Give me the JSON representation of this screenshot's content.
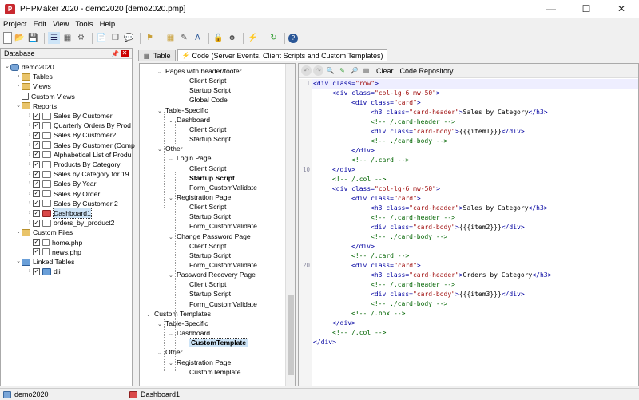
{
  "window": {
    "title": "PHPMaker 2020 - demo2020 [demo2020.pmp]",
    "logo": "P"
  },
  "menu": [
    "Project",
    "Edit",
    "View",
    "Tools",
    "Help"
  ],
  "left_panel": {
    "title": "Database",
    "items": [
      {
        "label": "demo2020",
        "indent": 0,
        "exp": "⌄",
        "icon": "db",
        "check": null
      },
      {
        "label": "Tables",
        "indent": 1,
        "exp": "›",
        "icon": "folder",
        "check": null
      },
      {
        "label": "Views",
        "indent": 1,
        "exp": "›",
        "icon": "folder",
        "check": null
      },
      {
        "label": "Custom Views",
        "indent": 1,
        "exp": "",
        "icon": "sql",
        "check": null
      },
      {
        "label": "Reports",
        "indent": 1,
        "exp": "⌄",
        "icon": "folder",
        "check": null
      },
      {
        "label": "Sales By Customer",
        "indent": 2,
        "exp": "›",
        "icon": "rep",
        "check": "✓"
      },
      {
        "label": "Quarterly Orders By Prod",
        "indent": 2,
        "exp": "›",
        "icon": "rep",
        "check": "✓"
      },
      {
        "label": "Sales By Customer2",
        "indent": 2,
        "exp": "›",
        "icon": "rep",
        "check": "✓"
      },
      {
        "label": "Sales By Customer (Comp",
        "indent": 2,
        "exp": "›",
        "icon": "rep",
        "check": "✓"
      },
      {
        "label": "Alphabetical List of Produ",
        "indent": 2,
        "exp": "›",
        "icon": "rep",
        "check": "✓"
      },
      {
        "label": "Products By Category",
        "indent": 2,
        "exp": "›",
        "icon": "rep",
        "check": "✓"
      },
      {
        "label": "Sales by Category for 19",
        "indent": 2,
        "exp": "›",
        "icon": "rep",
        "check": "✓"
      },
      {
        "label": "Sales By Year",
        "indent": 2,
        "exp": "›",
        "icon": "rep",
        "check": "✓"
      },
      {
        "label": "Sales By Order",
        "indent": 2,
        "exp": "›",
        "icon": "rep",
        "check": "✓"
      },
      {
        "label": "Sales By Customer 2",
        "indent": 2,
        "exp": "›",
        "icon": "rep",
        "check": "✓"
      },
      {
        "label": "Dashboard1",
        "indent": 2,
        "exp": "›",
        "icon": "dash",
        "check": "✓",
        "selected": true
      },
      {
        "label": "orders_by_product2",
        "indent": 2,
        "exp": "›",
        "icon": "rep",
        "check": "✓"
      },
      {
        "label": "Custom Files",
        "indent": 1,
        "exp": "⌄",
        "icon": "folder",
        "check": null
      },
      {
        "label": "home.php",
        "indent": 2,
        "exp": "",
        "icon": "file",
        "check": "✓"
      },
      {
        "label": "news.php",
        "indent": 2,
        "exp": "",
        "icon": "file",
        "check": "✓"
      },
      {
        "label": "Linked Tables",
        "indent": 1,
        "exp": "⌄",
        "icon": "link",
        "check": null
      },
      {
        "label": "dji",
        "indent": 2,
        "exp": "›",
        "icon": "link",
        "check": "✓"
      }
    ]
  },
  "tabs": [
    {
      "label": "Table",
      "active": false
    },
    {
      "label": "Code (Server Events, Client Scripts and Custom Templates)",
      "active": true
    }
  ],
  "mid_tree": [
    {
      "label": "Pages with header/footer",
      "x": 22,
      "exp": "⌄"
    },
    {
      "label": "Client Script",
      "x": 62,
      "exp": ""
    },
    {
      "label": "Startup Script",
      "x": 62,
      "exp": ""
    },
    {
      "label": "Global Code",
      "x": 62,
      "exp": ""
    },
    {
      "label": "Table-Specific",
      "x": 22,
      "exp": "⌄"
    },
    {
      "label": "Dashboard",
      "x": 36,
      "exp": "⌄"
    },
    {
      "label": "Client Script",
      "x": 62,
      "exp": ""
    },
    {
      "label": "Startup Script",
      "x": 62,
      "exp": ""
    },
    {
      "label": "Other",
      "x": 22,
      "exp": "⌄"
    },
    {
      "label": "Login Page",
      "x": 36,
      "exp": "⌄"
    },
    {
      "label": "Client Script",
      "x": 62,
      "exp": ""
    },
    {
      "label": "Startup Script",
      "x": 62,
      "exp": "",
      "bold": true
    },
    {
      "label": "Form_CustomValidate",
      "x": 62,
      "exp": ""
    },
    {
      "label": "Registration Page",
      "x": 36,
      "exp": "⌄"
    },
    {
      "label": "Client Script",
      "x": 62,
      "exp": ""
    },
    {
      "label": "Startup Script",
      "x": 62,
      "exp": ""
    },
    {
      "label": "Form_CustomValidate",
      "x": 62,
      "exp": ""
    },
    {
      "label": "Change Password Page",
      "x": 36,
      "exp": "⌄"
    },
    {
      "label": "Client Script",
      "x": 62,
      "exp": ""
    },
    {
      "label": "Startup Script",
      "x": 62,
      "exp": ""
    },
    {
      "label": "Form_CustomValidate",
      "x": 62,
      "exp": ""
    },
    {
      "label": "Password Recovery Page",
      "x": 36,
      "exp": "⌄"
    },
    {
      "label": "Client Script",
      "x": 62,
      "exp": ""
    },
    {
      "label": "Startup Script",
      "x": 62,
      "exp": ""
    },
    {
      "label": "Form_CustomValidate",
      "x": 62,
      "exp": ""
    },
    {
      "label": "Custom Templates",
      "x": 8,
      "exp": "⌄"
    },
    {
      "label": "Table-Specific",
      "x": 22,
      "exp": "⌄"
    },
    {
      "label": "Dashboard",
      "x": 36,
      "exp": "⌄"
    },
    {
      "label": "CustomTemplate",
      "x": 62,
      "exp": "",
      "bold": true,
      "selected": true
    },
    {
      "label": "Other",
      "x": 22,
      "exp": "⌄"
    },
    {
      "label": "Registration Page",
      "x": 36,
      "exp": "⌄"
    },
    {
      "label": "CustomTemplate",
      "x": 62,
      "exp": ""
    }
  ],
  "editor_toolbar": {
    "clear": "Clear",
    "repo": "Code Repository..."
  },
  "code_lines": [
    {
      "n": "1",
      "ind": 0,
      "parts": [
        [
          "t",
          "<div "
        ],
        [
          "t",
          "class="
        ],
        [
          "s",
          "\"row\""
        ],
        [
          "t",
          ">"
        ]
      ]
    },
    {
      "n": "",
      "ind": 1,
      "parts": [
        [
          "t",
          "<div "
        ],
        [
          "t",
          "class="
        ],
        [
          "s",
          "\"col-lg-6 mw-50\""
        ],
        [
          "t",
          ">"
        ]
      ]
    },
    {
      "n": "",
      "ind": 2,
      "parts": [
        [
          "t",
          "<div "
        ],
        [
          "t",
          "class="
        ],
        [
          "s",
          "\"card\""
        ],
        [
          "t",
          ">"
        ]
      ]
    },
    {
      "n": "",
      "ind": 3,
      "parts": [
        [
          "t",
          "<h3 "
        ],
        [
          "t",
          "class="
        ],
        [
          "s",
          "\"card-header\""
        ],
        [
          "t",
          ">"
        ],
        [
          "tx",
          "Sales by Category"
        ],
        [
          "t",
          "</h3>"
        ]
      ]
    },
    {
      "n": "",
      "ind": 3,
      "parts": [
        [
          "c",
          "<!-- /.card-header -->"
        ]
      ]
    },
    {
      "n": "",
      "ind": 3,
      "parts": [
        [
          "t",
          "<div "
        ],
        [
          "t",
          "class="
        ],
        [
          "s",
          "\"card-body\""
        ],
        [
          "t",
          ">"
        ],
        [
          "tx",
          "{{{item1}}}"
        ],
        [
          "t",
          "</div>"
        ]
      ]
    },
    {
      "n": "",
      "ind": 3,
      "parts": [
        [
          "c",
          "<!-- ./card-body -->"
        ]
      ]
    },
    {
      "n": "",
      "ind": 2,
      "parts": [
        [
          "t",
          "</div>"
        ]
      ]
    },
    {
      "n": "",
      "ind": 2,
      "parts": [
        [
          "c",
          "<!-- /.card -->"
        ]
      ]
    },
    {
      "n": "10",
      "ind": 1,
      "parts": [
        [
          "t",
          "</div>"
        ]
      ]
    },
    {
      "n": "",
      "ind": 1,
      "parts": [
        [
          "c",
          "<!-- /.col -->"
        ]
      ]
    },
    {
      "n": "",
      "ind": 1,
      "parts": [
        [
          "t",
          "<div "
        ],
        [
          "t",
          "class="
        ],
        [
          "s",
          "\"col-lg-6 mw-50\""
        ],
        [
          "t",
          ">"
        ]
      ]
    },
    {
      "n": "",
      "ind": 2,
      "parts": [
        [
          "t",
          "<div "
        ],
        [
          "t",
          "class="
        ],
        [
          "s",
          "\"card\""
        ],
        [
          "t",
          ">"
        ]
      ]
    },
    {
      "n": "",
      "ind": 3,
      "parts": [
        [
          "t",
          "<h3 "
        ],
        [
          "t",
          "class="
        ],
        [
          "s",
          "\"card-header\""
        ],
        [
          "t",
          ">"
        ],
        [
          "tx",
          "Sales by Category"
        ],
        [
          "t",
          "</h3>"
        ]
      ]
    },
    {
      "n": "",
      "ind": 3,
      "parts": [
        [
          "c",
          "<!-- /.card-header -->"
        ]
      ]
    },
    {
      "n": "",
      "ind": 3,
      "parts": [
        [
          "t",
          "<div "
        ],
        [
          "t",
          "class="
        ],
        [
          "s",
          "\"card-body\""
        ],
        [
          "t",
          ">"
        ],
        [
          "tx",
          "{{{item2}}}"
        ],
        [
          "t",
          "</div>"
        ]
      ]
    },
    {
      "n": "",
      "ind": 3,
      "parts": [
        [
          "c",
          "<!-- ./card-body -->"
        ]
      ]
    },
    {
      "n": "",
      "ind": 2,
      "parts": [
        [
          "t",
          "</div>"
        ]
      ]
    },
    {
      "n": "",
      "ind": 2,
      "parts": [
        [
          "c",
          "<!-- /.card -->"
        ]
      ]
    },
    {
      "n": "20",
      "ind": 2,
      "parts": [
        [
          "t",
          "<div "
        ],
        [
          "t",
          "class="
        ],
        [
          "s",
          "\"card\""
        ],
        [
          "t",
          ">"
        ]
      ]
    },
    {
      "n": "",
      "ind": 3,
      "parts": [
        [
          "t",
          "<h3 "
        ],
        [
          "t",
          "class="
        ],
        [
          "s",
          "\"card-header\""
        ],
        [
          "t",
          ">"
        ],
        [
          "tx",
          "Orders by Category"
        ],
        [
          "t",
          "</h3>"
        ]
      ]
    },
    {
      "n": "",
      "ind": 3,
      "parts": [
        [
          "c",
          "<!-- /.card-header -->"
        ]
      ]
    },
    {
      "n": "",
      "ind": 3,
      "parts": [
        [
          "t",
          "<div "
        ],
        [
          "t",
          "class="
        ],
        [
          "s",
          "\"card-body\""
        ],
        [
          "t",
          ">"
        ],
        [
          "tx",
          "{{{item3}}}"
        ],
        [
          "t",
          "</div>"
        ]
      ]
    },
    {
      "n": "",
      "ind": 3,
      "parts": [
        [
          "c",
          "<!-- ./card-body -->"
        ]
      ]
    },
    {
      "n": "",
      "ind": 2,
      "parts": [
        [
          "c",
          "<!-- /.box -->"
        ]
      ]
    },
    {
      "n": "",
      "ind": 1,
      "parts": [
        [
          "t",
          "</div>"
        ]
      ]
    },
    {
      "n": "",
      "ind": 1,
      "parts": [
        [
          "c",
          "<!-- /.col -->"
        ]
      ]
    },
    {
      "n": "",
      "ind": 0,
      "parts": [
        [
          "t",
          "</div>"
        ]
      ]
    }
  ],
  "status": {
    "project": "demo2020",
    "page": "Dashboard1"
  }
}
